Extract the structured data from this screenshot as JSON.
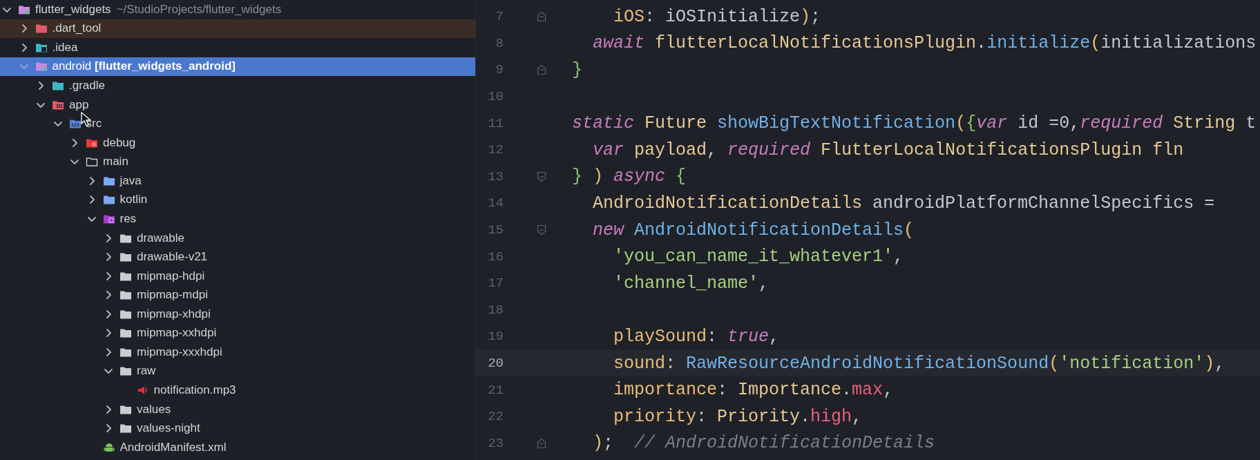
{
  "project_tree": {
    "name": "flutter_widgets",
    "path": "~/StudioProjects/flutter_widgets",
    "kind": "module",
    "expanded": true,
    "selected": false,
    "excluded": false,
    "children": [
      {
        "name": ".dart_tool",
        "kind": "folder_excluded",
        "expanded": false,
        "selected": false,
        "excluded": true
      },
      {
        "name": ".idea",
        "kind": "folder_idea",
        "expanded": false,
        "selected": false,
        "excluded": false
      },
      {
        "name": "android **[flutter_widgets_android]**",
        "kind": "module",
        "expanded": true,
        "selected": true,
        "excluded": false,
        "children": [
          {
            "name": ".gradle",
            "kind": "folder_gradle",
            "expanded": false,
            "selected": false,
            "excluded": false
          },
          {
            "name": "app",
            "kind": "folder_app",
            "expanded": true,
            "selected": false,
            "excluded": false,
            "children": [
              {
                "name": "src",
                "kind": "folder_src",
                "expanded": true,
                "selected": false,
                "excluded": false,
                "children": [
                  {
                    "name": "debug",
                    "kind": "folder_debug",
                    "expanded": false,
                    "selected": false,
                    "excluded": false
                  },
                  {
                    "name": "main",
                    "kind": "folder_outline",
                    "expanded": true,
                    "selected": false,
                    "excluded": false,
                    "children": [
                      {
                        "name": "java",
                        "kind": "folder_blue",
                        "expanded": false,
                        "selected": false,
                        "excluded": false
                      },
                      {
                        "name": "kotlin",
                        "kind": "folder_blue",
                        "expanded": false,
                        "selected": false,
                        "excluded": false
                      },
                      {
                        "name": "res",
                        "kind": "folder_res",
                        "expanded": true,
                        "selected": false,
                        "excluded": false,
                        "children": [
                          {
                            "name": "drawable",
                            "kind": "folder",
                            "expanded": false,
                            "selected": false,
                            "excluded": false
                          },
                          {
                            "name": "drawable-v21",
                            "kind": "folder",
                            "expanded": false,
                            "selected": false,
                            "excluded": false
                          },
                          {
                            "name": "mipmap-hdpi",
                            "kind": "folder",
                            "expanded": false,
                            "selected": false,
                            "excluded": false
                          },
                          {
                            "name": "mipmap-mdpi",
                            "kind": "folder",
                            "expanded": false,
                            "selected": false,
                            "excluded": false
                          },
                          {
                            "name": "mipmap-xhdpi",
                            "kind": "folder",
                            "expanded": false,
                            "selected": false,
                            "excluded": false
                          },
                          {
                            "name": "mipmap-xxhdpi",
                            "kind": "folder",
                            "expanded": false,
                            "selected": false,
                            "excluded": false
                          },
                          {
                            "name": "mipmap-xxxhdpi",
                            "kind": "folder",
                            "expanded": false,
                            "selected": false,
                            "excluded": false
                          },
                          {
                            "name": "raw",
                            "kind": "folder",
                            "expanded": true,
                            "selected": false,
                            "excluded": false,
                            "children": [
                              {
                                "name": "notification.mp3",
                                "kind": "audio",
                                "selected": false,
                                "excluded": false
                              }
                            ]
                          },
                          {
                            "name": "values",
                            "kind": "folder",
                            "expanded": false,
                            "selected": false,
                            "excluded": false
                          },
                          {
                            "name": "values-night",
                            "kind": "folder",
                            "expanded": false,
                            "selected": false,
                            "excluded": false
                          }
                        ]
                      },
                      {
                        "name": "AndroidManifest.xml",
                        "kind": "android",
                        "selected": false,
                        "excluded": false
                      }
                    ]
                  }
                ]
              }
            ]
          }
        ]
      }
    ]
  },
  "editor": {
    "lines": [
      {
        "number": "7",
        "kind": "fold_end",
        "current": false,
        "tokens": [
          {
            "text": "    iOS",
            "kind": "prop"
          },
          {
            "text": ": iOSInitialize",
            "kind": "plain"
          },
          {
            "text": ")",
            "kind": "paren"
          },
          {
            "text": ";",
            "kind": "plain"
          }
        ]
      },
      {
        "number": "8",
        "kind": "code",
        "current": false,
        "tokens": [
          {
            "text": "  await ",
            "kind": "kw"
          },
          {
            "text": "flutterLocalNotificationsPlugin",
            "kind": "type"
          },
          {
            "text": ".",
            "kind": "plain"
          },
          {
            "text": "initialize",
            "kind": "fn"
          },
          {
            "text": "(",
            "kind": "paren"
          },
          {
            "text": "initializations",
            "kind": "plain"
          }
        ]
      },
      {
        "number": "9",
        "kind": "fold_end",
        "current": false,
        "tokens": [
          {
            "text": "}",
            "kind": "brace"
          }
        ]
      },
      {
        "number": "10",
        "kind": "code",
        "current": false
      },
      {
        "number": "11",
        "kind": "code",
        "current": false,
        "tokens": [
          {
            "text": "static ",
            "kind": "kw"
          },
          {
            "text": "Future ",
            "kind": "type"
          },
          {
            "text": "showBigTextNotification",
            "kind": "fn"
          },
          {
            "text": "(",
            "kind": "paren"
          },
          {
            "text": "{",
            "kind": "brace"
          },
          {
            "text": "var ",
            "kind": "kw"
          },
          {
            "text": "id =0,",
            "kind": "plain"
          },
          {
            "text": "required ",
            "kind": "kw"
          },
          {
            "text": "String ",
            "kind": "type"
          },
          {
            "text": "t",
            "kind": "plain"
          }
        ]
      },
      {
        "number": "12",
        "kind": "code",
        "current": false,
        "tokens": [
          {
            "text": "  var ",
            "kind": "kw"
          },
          {
            "text": "payload",
            "kind": "type"
          },
          {
            "text": ", ",
            "kind": "plain"
          },
          {
            "text": "required ",
            "kind": "kw"
          },
          {
            "text": "FlutterLocalNotificationsPlugin fln",
            "kind": "type"
          }
        ]
      },
      {
        "number": "13",
        "kind": "fold_start",
        "current": false,
        "tokens": [
          {
            "text": "} ",
            "kind": "brace"
          },
          {
            "text": ") ",
            "kind": "paren"
          },
          {
            "text": "async ",
            "kind": "kw"
          },
          {
            "text": "{",
            "kind": "brace"
          }
        ]
      },
      {
        "number": "14",
        "kind": "code",
        "current": false,
        "tokens": [
          {
            "text": "  AndroidNotificationDetails ",
            "kind": "type"
          },
          {
            "text": "androidPlatformChannelSpecifics =",
            "kind": "plain"
          }
        ]
      },
      {
        "number": "15",
        "kind": "fold_start",
        "current": false,
        "tokens": [
          {
            "text": "  new ",
            "kind": "kw"
          },
          {
            "text": "AndroidNotificationDetails",
            "kind": "fn"
          },
          {
            "text": "(",
            "kind": "paren"
          }
        ]
      },
      {
        "number": "16",
        "kind": "code",
        "current": false,
        "tokens": [
          {
            "text": "    'you_can_name_it_whatever1'",
            "kind": "str"
          },
          {
            "text": ",",
            "kind": "plain"
          }
        ]
      },
      {
        "number": "17",
        "kind": "code",
        "current": false,
        "tokens": [
          {
            "text": "    'channel_name'",
            "kind": "str"
          },
          {
            "text": ",",
            "kind": "plain"
          }
        ]
      },
      {
        "number": "18",
        "kind": "code",
        "current": false
      },
      {
        "number": "19",
        "kind": "code",
        "current": false,
        "tokens": [
          {
            "text": "    playSound",
            "kind": "prop"
          },
          {
            "text": ": ",
            "kind": "plain"
          },
          {
            "text": "true",
            "kind": "kw"
          },
          {
            "text": ",",
            "kind": "plain"
          }
        ]
      },
      {
        "number": "20",
        "kind": "code",
        "current": true,
        "tokens": [
          {
            "text": "    sound",
            "kind": "prop"
          },
          {
            "text": ": ",
            "kind": "plain"
          },
          {
            "text": "RawResourceAndroidNotificationSound",
            "kind": "fn"
          },
          {
            "text": "(",
            "kind": "paren"
          },
          {
            "text": "'notification'",
            "kind": "str"
          },
          {
            "text": ")",
            "kind": "paren"
          },
          {
            "text": ",",
            "kind": "plain"
          }
        ]
      },
      {
        "number": "21",
        "kind": "code",
        "current": false,
        "tokens": [
          {
            "text": "    importance",
            "kind": "prop"
          },
          {
            "text": ": ",
            "kind": "plain"
          },
          {
            "text": "Importance",
            "kind": "type"
          },
          {
            "text": ".",
            "kind": "plain"
          },
          {
            "text": "max",
            "kind": "const"
          },
          {
            "text": ",",
            "kind": "plain"
          }
        ]
      },
      {
        "number": "22",
        "kind": "code",
        "current": false,
        "tokens": [
          {
            "text": "    priority",
            "kind": "prop"
          },
          {
            "text": ": ",
            "kind": "plain"
          },
          {
            "text": "Priority",
            "kind": "type"
          },
          {
            "text": ".",
            "kind": "plain"
          },
          {
            "text": "high",
            "kind": "const"
          },
          {
            "text": ",",
            "kind": "plain"
          }
        ]
      },
      {
        "number": "23",
        "kind": "fold_end",
        "current": false,
        "tokens": [
          {
            "text": "  )",
            "kind": "paren"
          },
          {
            "text": ";  ",
            "kind": "plain"
          },
          {
            "text": "// AndroidNotificationDetails",
            "kind": "comment"
          }
        ]
      }
    ]
  }
}
